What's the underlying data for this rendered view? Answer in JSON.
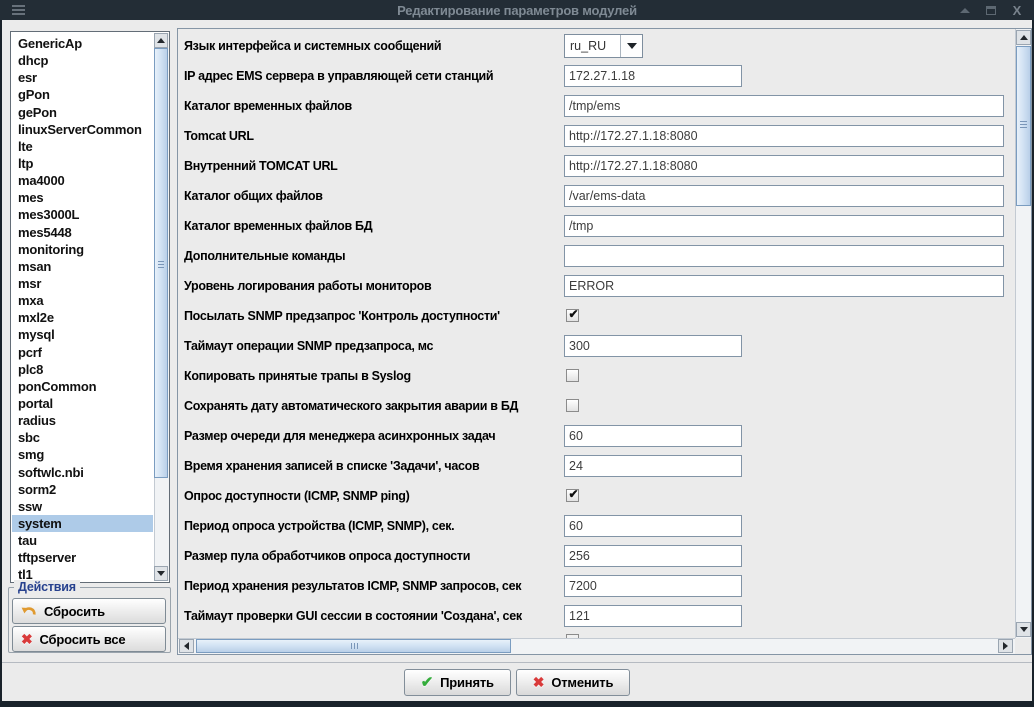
{
  "window": {
    "title": "Редактирование параметров модулей",
    "controls": [
      "shade",
      "maximize",
      "close"
    ]
  },
  "sidebar": {
    "modules": [
      "GenericAp",
      "dhcp",
      "esr",
      "gPon",
      "gePon",
      "linuxServerCommon",
      "lte",
      "ltp",
      "ma4000",
      "mes",
      "mes3000L",
      "mes5448",
      "monitoring",
      "msan",
      "msr",
      "mxa",
      "mxl2e",
      "mysql",
      "pcrf",
      "plc8",
      "ponCommon",
      "portal",
      "radius",
      "sbc",
      "smg",
      "softwlc.nbi",
      "sorm2",
      "ssw",
      "system",
      "tau",
      "tftpserver",
      "tl1"
    ],
    "selected_module": "system",
    "actions": {
      "title": "Действия",
      "reset": "Сбросить",
      "reset_all": "Сбросить все"
    }
  },
  "form": {
    "rows": [
      {
        "label": "Язык интерфейса и системных сообщений",
        "type": "combo",
        "value": "ru_RU"
      },
      {
        "label": "IP адрес EMS сервера в управляющей сети станций",
        "type": "text",
        "value": "172.27.1.18",
        "size": "medium"
      },
      {
        "label": "Каталог временных файлов",
        "type": "text",
        "value": "/tmp/ems",
        "size": "full"
      },
      {
        "label": "Tomcat URL",
        "type": "text",
        "value": "http://172.27.1.18:8080",
        "size": "full"
      },
      {
        "label": "Внутренний TOMCAT URL",
        "type": "text",
        "value": "http://172.27.1.18:8080",
        "size": "full"
      },
      {
        "label": "Каталог общих файлов",
        "type": "text",
        "value": "/var/ems-data",
        "size": "full"
      },
      {
        "label": "Каталог временных файлов БД",
        "type": "text",
        "value": "/tmp",
        "size": "full"
      },
      {
        "label": "Дополнительные команды",
        "type": "text",
        "value": "",
        "size": "full"
      },
      {
        "label": "Уровень логирования работы мониторов",
        "type": "text",
        "value": "ERROR",
        "size": "full"
      },
      {
        "label": "Посылать SNMP предзапрос 'Контроль доступности'",
        "type": "checkbox",
        "checked": true
      },
      {
        "label": "Таймаут операции SNMP предзапроса, мс",
        "type": "text",
        "value": "300",
        "size": "medium"
      },
      {
        "label": "Копировать принятые трапы в Syslog",
        "type": "checkbox",
        "checked": false
      },
      {
        "label": "Сохранять дату автоматического закрытия аварии в БД",
        "type": "checkbox",
        "checked": false
      },
      {
        "label": "Размер очереди для менеджера асинхронных задач",
        "type": "text",
        "value": "60",
        "size": "medium"
      },
      {
        "label": "Время хранения записей в списке 'Задачи', часов",
        "type": "text",
        "value": "24",
        "size": "medium"
      },
      {
        "label": "Опрос доступности (ICMP, SNMP ping)",
        "type": "checkbox",
        "checked": true
      },
      {
        "label": "Период опроса устройства (ICMP, SNMP), сек.",
        "type": "text",
        "value": "60",
        "size": "medium"
      },
      {
        "label": "Размер пула обработчиков опроса доступности",
        "type": "text",
        "value": "256",
        "size": "medium"
      },
      {
        "label": "Период хранения результатов ICMP, SNMP запросов, сек",
        "type": "text",
        "value": "7200",
        "size": "medium"
      },
      {
        "label": "Таймаут проверки GUI сессии в состоянии 'Создана', сек",
        "type": "text",
        "value": "121",
        "size": "medium"
      }
    ]
  },
  "footer": {
    "accept": "Принять",
    "cancel": "Отменить"
  },
  "colors": {
    "titlebar": "#232d36",
    "selection": "#aecbe8",
    "scrollbar_accent": "#b9cfe8",
    "group_title": "#27418e",
    "accept_icon": "#35ad3c",
    "cancel_icon": "#d93a3a",
    "undo_icon": "#e09a30"
  }
}
